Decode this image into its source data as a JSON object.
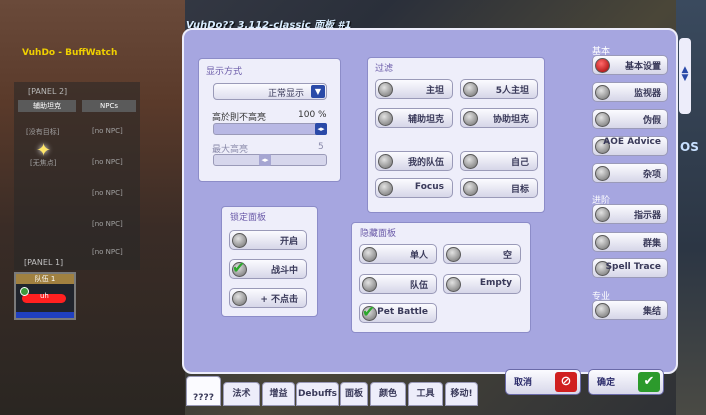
{
  "window": {
    "title": "VuhDo?? 3.112-classic 面板 #1"
  },
  "buffwatch": {
    "title": "VuhDo - BuffWatch"
  },
  "panel2": {
    "label": "[PANEL 2]",
    "headers": [
      "辅助坦克",
      "NPCs"
    ],
    "left_cells": [
      "[没有目标]",
      "[无焦点]"
    ],
    "right_cells": [
      "[no NPC]",
      "[no NPC]",
      "[no NPC]",
      "[no NPC]",
      "[no NPC]"
    ]
  },
  "panel1": {
    "label": "[PANEL 1]",
    "header": "队伍 1",
    "unit": "uh"
  },
  "display": {
    "group_label": "显示方式",
    "mode_value": "正常显示",
    "hide_label": "高於則不高亮",
    "hide_value": "100 %",
    "max_label": "最大高亮",
    "max_value": "5"
  },
  "filter": {
    "group_label": "过滤",
    "buttons": [
      "主坦",
      "5人主坦",
      "辅助坦克",
      "协助坦克",
      "我的队伍",
      "自己",
      "Focus",
      "目标"
    ]
  },
  "lock": {
    "group_label": "锁定面板",
    "buttons": [
      "开启",
      "战斗中",
      "+ 不点击"
    ]
  },
  "hide": {
    "group_label": "隐藏面板",
    "buttons": [
      "单人",
      "空",
      "队伍",
      "Empty",
      "Pet Battle"
    ]
  },
  "side": {
    "basic_label": "基本",
    "basic_buttons": [
      "基本设置",
      "监视器",
      "伪假",
      "AOE Advice",
      "杂项"
    ],
    "advanced_label": "进阶",
    "advanced_buttons": [
      "指示器",
      "群集",
      "Spell Trace"
    ],
    "pro_label": "专业",
    "pro_buttons": [
      "集结"
    ]
  },
  "footer": {
    "cancel": "取消",
    "ok": "确定"
  },
  "tabs": [
    "????",
    "法术",
    "增益",
    "Debuffs",
    "面板",
    "颜色",
    "工具",
    "移动!"
  ],
  "misc": {
    "side_text": "OS"
  }
}
